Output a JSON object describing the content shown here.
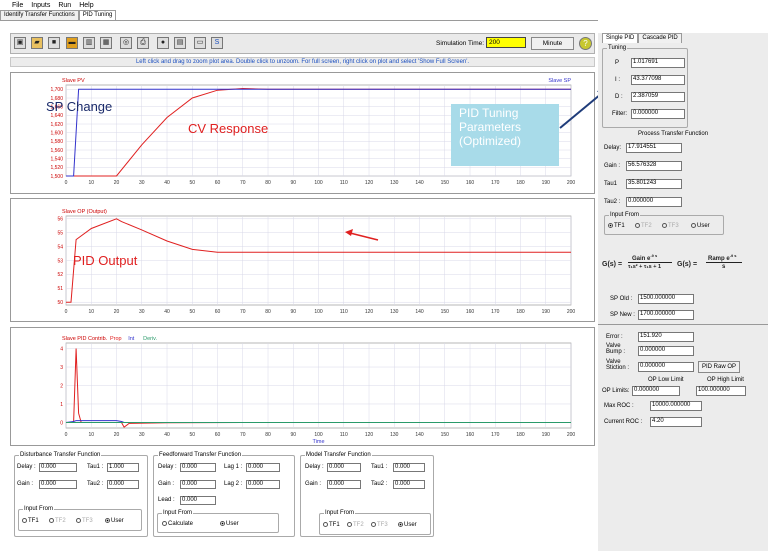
{
  "menu": {
    "items": [
      "File",
      "Inputs",
      "Run",
      "Help"
    ]
  },
  "tabs": [
    {
      "label": "Identify Transfer Functions"
    },
    {
      "label": "PID Tuning"
    }
  ],
  "toolbar": {
    "simulation_time_label": "Simulation Time:",
    "simulation_time_value": "200",
    "minute_label": "Minute",
    "help_icon": "?"
  },
  "instruction": "Left click and drag to zoom plot area. Double click to unzoom. For full screen, right click on plot and select 'Show Full Screen'.",
  "annotations": {
    "sp_change": "SP Change",
    "cv_response": "CV Response",
    "pid_output": "PID Output",
    "pid_tuning_params": "PID Tuning Parameters (Optimized)"
  },
  "chart_data": [
    {
      "type": "line",
      "title": "Slave PV",
      "legend_right": "Slave SP",
      "x": [
        0,
        3,
        5,
        20,
        30,
        40,
        50,
        60,
        70,
        80,
        90,
        100,
        200
      ],
      "series": [
        {
          "name": "Slave PV",
          "color": "#e02020",
          "values": [
            1500,
            1500,
            1500,
            1500,
            1572,
            1635,
            1680,
            1698,
            1702,
            1700,
            1700,
            1700,
            1700
          ]
        },
        {
          "name": "Slave SP",
          "color": "#3333cc",
          "values": [
            1500,
            1500,
            1700,
            1700,
            1700,
            1700,
            1700,
            1700,
            1700,
            1700,
            1700,
            1700,
            1700
          ]
        }
      ],
      "ylim": [
        1500,
        1710
      ],
      "ytick_labels": [
        "1,700",
        "1,680",
        "1,660",
        "1,640",
        "1,620",
        "1,600",
        "1,580",
        "1,560",
        "1,540",
        "1,520",
        "1,500"
      ],
      "xtick_labels": [
        "0",
        "10",
        "20",
        "30",
        "40",
        "50",
        "60",
        "70",
        "80",
        "90",
        "100",
        "110",
        "120",
        "130",
        "140",
        "150",
        "160",
        "170",
        "180",
        "190",
        "200"
      ]
    },
    {
      "type": "line",
      "title": "Slave OP (Output)",
      "x": [
        0,
        2,
        4,
        10,
        20,
        22,
        30,
        40,
        50,
        60,
        70,
        80,
        200
      ],
      "series": [
        {
          "name": "Slave OP (Output)",
          "color": "#e02020",
          "values": [
            50,
            50,
            54.5,
            55.3,
            56,
            55.8,
            55.2,
            54.4,
            53.8,
            53.6,
            53.6,
            53.6,
            53.6
          ]
        }
      ],
      "ylim": [
        49.8,
        56.2
      ],
      "ytick_labels": [
        "56",
        "55",
        "54",
        "53",
        "52",
        "51",
        "50"
      ],
      "xtick_labels": [
        "0",
        "10",
        "20",
        "30",
        "40",
        "50",
        "60",
        "70",
        "80",
        "90",
        "100",
        "110",
        "120",
        "130",
        "140",
        "150",
        "160",
        "170",
        "180",
        "190",
        "200"
      ]
    },
    {
      "type": "line",
      "title": "Slave PID Contrib.",
      "xlabel": "Time",
      "x": [
        0,
        3,
        4,
        5,
        6,
        10,
        20,
        22,
        23,
        25,
        40,
        70,
        200
      ],
      "series": [
        {
          "name": "Prop",
          "color": "#e02020",
          "values": [
            0,
            0,
            4,
            0.5,
            0,
            0,
            0,
            0,
            -0.25,
            -0.05,
            -0.02,
            0,
            0
          ]
        },
        {
          "name": "Int",
          "color": "#3333cc",
          "values": [
            0,
            0.05,
            0.1,
            0.1,
            0.1,
            0.1,
            0.1,
            0.05,
            0,
            0,
            0,
            0,
            0
          ]
        },
        {
          "name": "Deriv.",
          "color": "#2a9a6a",
          "values": [
            0,
            0,
            0,
            0,
            0,
            0,
            0,
            0,
            0,
            0,
            0,
            0,
            0
          ]
        }
      ],
      "ylim": [
        -0.3,
        4.3
      ],
      "ytick_labels": [
        "4",
        "3",
        "2",
        "1",
        "0"
      ],
      "xtick_labels": [
        "0",
        "10",
        "20",
        "30",
        "40",
        "50",
        "60",
        "70",
        "80",
        "90",
        "100",
        "110",
        "120",
        "130",
        "140",
        "150",
        "160",
        "170",
        "180",
        "190",
        "200"
      ]
    }
  ],
  "disturbance": {
    "title": "Disturbance Transfer Function",
    "delay_label": "Delay :",
    "delay": "0.000",
    "tau1_label": "Tau1 :",
    "tau1": "1.000",
    "gain_label": "Gain :",
    "gain": "0.000",
    "tau2_label": "Tau2 :",
    "tau2": "0.000",
    "input_from_label": "Input From",
    "options": [
      "TF1",
      "TF2",
      "TF3",
      "User"
    ],
    "selected": "User"
  },
  "feedforward": {
    "title": "Feedforward Transfer Function",
    "delay_label": "Delay :",
    "delay": "0.000",
    "lag1_label": "Lag 1 :",
    "lag1": "0.000",
    "gain_label": "Gain :",
    "gain": "0.000",
    "lag2_label": "Lag 2 :",
    "lag2": "0.000",
    "lead_label": "Lead :",
    "lead": "0.000",
    "input_from_label": "Input From",
    "options": [
      "Calculate",
      "User"
    ],
    "selected": "User"
  },
  "model": {
    "title": "Model Transfer Function",
    "delay_label": "Delay :",
    "delay": "0.000",
    "tau1_label": "Tau1 :",
    "tau1": "0.000",
    "gain_label": "Gain :",
    "gain": "0.000",
    "tau2_label": "Tau2 :",
    "tau2": "0.000",
    "input_from_label": "Input From",
    "options": [
      "TF1",
      "TF2",
      "TF3",
      "User"
    ],
    "selected": "User"
  },
  "right_panel": {
    "tabs": [
      {
        "label": "Single PID"
      },
      {
        "label": "Cascade PID"
      }
    ],
    "tuning": {
      "title": "Tuning",
      "p_label": "P",
      "p": "1.017691",
      "i_label": "I :",
      "i": "43.377098",
      "d_label": "D :",
      "d": "2.387059",
      "filter_label": "Filter:",
      "filter": "0.000000"
    },
    "process_tf": {
      "title": "Process Transfer Function",
      "delay_label": "Delay:",
      "delay": "17.914551",
      "gain_label": "Gain :",
      "gain": "56.576328",
      "tau1_label": "Tau1",
      "tau1": "35.801243",
      "tau2_label": "Tau2 :",
      "tau2": "0.000000",
      "input_from_label": "Input From",
      "options": [
        "TF1",
        "TF2",
        "TF3",
        "User"
      ],
      "selected": "TF1"
    },
    "formulas": {
      "gs_label": "G(s) =",
      "gain_num": "Gain e",
      "ramp_num": "Ramp e",
      "exp": "-θ s",
      "den1": "τ₁s² + τ₁s + 1",
      "den2": "s"
    },
    "sp_old_label": "SP Old :",
    "sp_old": "1500.000000",
    "sp_new_label": "SP New :",
    "sp_new": "1700.000000",
    "error_label": "Error :",
    "error": "151.920",
    "valve_bump_label": "Valve Bump :",
    "valve_bump": "0.000000",
    "valve_stiction_label": "Valve Stiction :",
    "valve_stiction": "0.000000",
    "pid_raw_op_label": "PID Raw OP",
    "op_low_limit_label": "OP Low Limit",
    "op_high_limit_label": "OP High Limit",
    "op_limits_label": "OP Limits:",
    "op_low": "0.000000",
    "op_high": "100.000000",
    "max_roc_label": "Max ROC :",
    "max_roc": "10000.000000",
    "current_roc_label": "Current ROC :",
    "current_roc": "4.20"
  }
}
